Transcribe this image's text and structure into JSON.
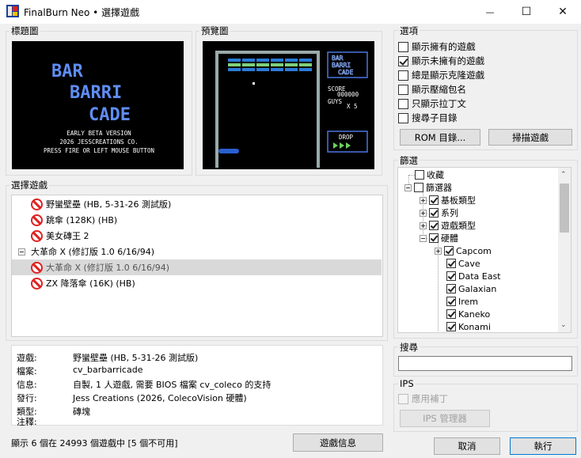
{
  "window": {
    "title": "FinalBurn Neo • 選擇遊戲",
    "minimize_glyph": "—",
    "maximize_glyph": "☐",
    "close_glyph": "✕"
  },
  "title_screen": {
    "label": "標題圖",
    "logo_lines": [
      "BAR",
      "BARRI",
      "CADE"
    ],
    "line1": "EARLY BETA VERSION",
    "line2": "2026 JESSCREATIONS CO.",
    "line3": "PRESS FIRE OR LEFT MOUSE BUTTON"
  },
  "preview": {
    "label": "預覽圖",
    "logo_lines": [
      "BAR",
      "BARRI",
      "CADE"
    ],
    "score_label": "SCORE",
    "score_value": "000000",
    "guys_label": "GUYS",
    "guys_value": "X 5",
    "drop_label": "DROP"
  },
  "game_list": {
    "label": "選擇遊戲",
    "rows": [
      {
        "text": "野蠻壁壘 (HB, 5-31-26 測試版)"
      },
      {
        "text": "跳傘 (128K) (HB)"
      },
      {
        "text": "美女磚王 2"
      },
      {
        "text": "大革命 X (修訂版 1.0 6/16/94)"
      },
      {
        "text": "大革命 X (修訂版 1.0 6/16/94)"
      },
      {
        "text": "ZX 降落傘 (16K) (HB)"
      }
    ]
  },
  "info": {
    "rows": [
      {
        "label": "遊戲:",
        "value": "野蠻壁壘 (HB, 5-31-26 測試版)"
      },
      {
        "label": "檔案:",
        "value": "cv_barbarricade"
      },
      {
        "label": "信息:",
        "value": "自製, 1 人遊戲, 需要 BIOS 檔案 cv_coleco 的支持"
      },
      {
        "label": "發行:",
        "value": "Jess Creations (2026, ColecoVision 硬體)"
      },
      {
        "label": "類型:",
        "value": "磚塊"
      },
      {
        "label": "注釋:",
        "value": ""
      }
    ]
  },
  "status": {
    "text": "顯示 6 個在 24993 個遊戲中 [5 個不可用]",
    "game_info_button": "遊戲信息"
  },
  "options": {
    "label": "選項",
    "items": [
      {
        "label": "顯示擁有的遊戲",
        "checked": false
      },
      {
        "label": "顯示未擁有的遊戲",
        "checked": true
      },
      {
        "label": "總是顯示克隆遊戲",
        "checked": false
      },
      {
        "label": "顯示壓縮包名",
        "checked": false
      },
      {
        "label": "只顯示拉丁文",
        "checked": false
      },
      {
        "label": "搜尋子目錄",
        "checked": false
      }
    ],
    "rom_dirs_button": "ROM 目錄...",
    "scan_button": "掃描遊戲"
  },
  "filter": {
    "label": "篩選",
    "items": [
      {
        "label": "收藏",
        "checked": false
      },
      {
        "label": "篩選器",
        "checked": false
      },
      {
        "label": "基板類型",
        "checked": true
      },
      {
        "label": "系列",
        "checked": true
      },
      {
        "label": "遊戲類型",
        "checked": true
      },
      {
        "label": "硬體",
        "checked": true
      },
      {
        "label": "Capcom",
        "checked": true
      },
      {
        "label": "Cave",
        "checked": true
      },
      {
        "label": "Data East",
        "checked": true
      },
      {
        "label": "Galaxian",
        "checked": true
      },
      {
        "label": "Irem",
        "checked": true
      },
      {
        "label": "Kaneko",
        "checked": true
      },
      {
        "label": "Konami",
        "checked": true
      }
    ]
  },
  "search": {
    "label": "搜尋",
    "value": "",
    "placeholder": ""
  },
  "ips": {
    "label": "IPS",
    "apply_patch": "應用補丁",
    "manager_button": "IPS 管理器"
  },
  "footer": {
    "cancel": "取消",
    "ok": "執行"
  },
  "colors": {
    "accent": "#0078d7",
    "error_icon": "#e02020",
    "selected_row": "#d9d9d9",
    "logo_blue": "#5f8df4"
  }
}
